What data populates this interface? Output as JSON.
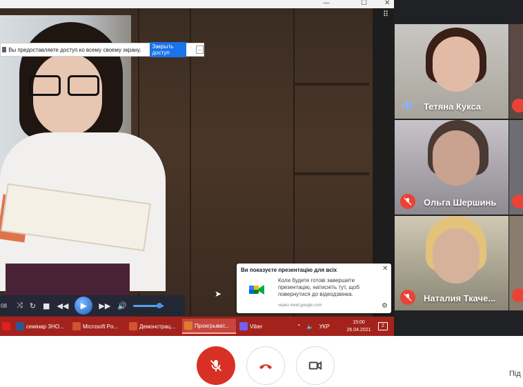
{
  "screen_share": {
    "window_controls": [
      "—",
      "☐",
      "✕"
    ],
    "share_bar": {
      "text": "Вы предоставляете доступ ко всему своему экрану.",
      "stop_button": "Закрыть доступ",
      "more_button": "..."
    },
    "player": {
      "time": "08"
    },
    "toast": {
      "title": "Ви показуєте презентацію для всіх",
      "body": "Коли будете готові завершити презентацію, натисніть тут, щоб повернутися до відеодзвінка.",
      "source": "через meet.google.com"
    },
    "taskbar": {
      "items": [
        {
          "label": "семінар ЗНО...",
          "color": "#2b5797"
        },
        {
          "label": "Microsoft Po...",
          "color": "#d35230"
        },
        {
          "label": "Демонстрац...",
          "color": "#d35230"
        },
        {
          "label": "Проигрыват...",
          "color": "#e07b2e",
          "active": true
        },
        {
          "label": "Viber",
          "color": "#7360f2"
        }
      ],
      "lang": "УКР",
      "time": "15:00",
      "date": "26.04.2021",
      "notifications": "2"
    }
  },
  "participants": [
    {
      "name": "Тетяна Кукса",
      "speaking": true
    },
    {
      "name": "Ольга Шершинь",
      "muted": true
    },
    {
      "name": "Наталия Ткаче...",
      "muted": true
    }
  ],
  "controls": {
    "join_label": "Під"
  },
  "colors": {
    "meet_red": "#d93025",
    "taskbar": "#a3231c",
    "tile_bg": "#202124"
  }
}
